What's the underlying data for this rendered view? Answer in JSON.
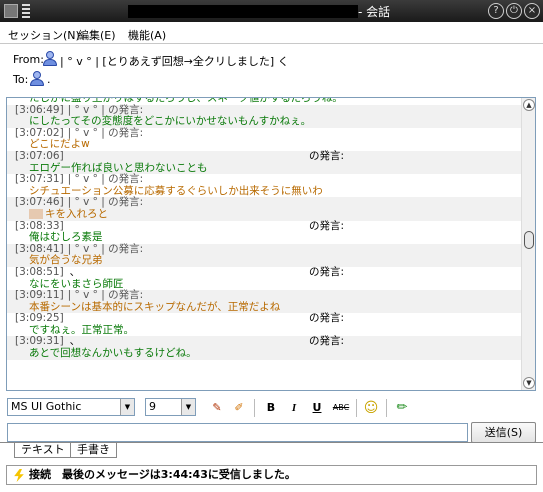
{
  "window": {
    "title": "- 会話",
    "controls": [
      "help-icon",
      "minimize-icon",
      "close-icon"
    ]
  },
  "menu": {
    "items": [
      {
        "label": "セッション(N)"
      },
      {
        "label": "編集(E)"
      },
      {
        "label": "機能(A)"
      }
    ]
  },
  "header": {
    "from_label": "From:",
    "from_value": "| ° v ° | [とりあえず回想→全クリしました] く",
    "to_label": "To:",
    "to_value": "."
  },
  "chat": {
    "said_label": "の発言:",
    "lines": [
      {
        "kind": "msg",
        "color": "green",
        "text": "たしかに盛り上がりはするだろうし、スネーク値がするだろうね。"
      },
      {
        "kind": "hdr",
        "ts": "[3:06:49]",
        "nick": "| ° v ° | の発言:",
        "alt": true
      },
      {
        "kind": "msg",
        "color": "green",
        "text": "にしたってその変態度をどこかにいかせないもんすかねぇ。",
        "alt": true
      },
      {
        "kind": "hdr",
        "ts": "[3:07:02]",
        "nick": "| ° v ° | の発言:"
      },
      {
        "kind": "msg",
        "color": "orange",
        "text": "どこにだよw"
      },
      {
        "kind": "hdr",
        "ts": "[3:07:06]",
        "nick": "",
        "alt": true
      },
      {
        "kind": "msg",
        "color": "green",
        "text": "エロゲー作れば良いと思わないことも",
        "alt": true
      },
      {
        "kind": "hdr",
        "ts": "[3:07:31]",
        "nick": "| ° v ° | の発言:"
      },
      {
        "kind": "msg",
        "color": "orange",
        "text": "シチュエーション公募に応募するぐらいしか出来そうに無いわ"
      },
      {
        "kind": "hdr",
        "ts": "[3:07:46]",
        "nick": "| ° v ° | の発言:",
        "alt": true
      },
      {
        "kind": "msg",
        "color": "orange",
        "text": "キを入れろと",
        "alt": true,
        "redact_prefix": true
      },
      {
        "kind": "hdr",
        "ts": "[3:08:33]",
        "nick": ""
      },
      {
        "kind": "msg",
        "color": "green",
        "text": "俺はむしろ素是"
      },
      {
        "kind": "hdr",
        "ts": "[3:08:41]",
        "nick": "| ° v ° | の発言:",
        "alt": true
      },
      {
        "kind": "msg",
        "color": "orange",
        "text": "気が合うな兄弟",
        "alt": true
      },
      {
        "kind": "hdr",
        "ts": "[3:08:51]",
        "nick": "、"
      },
      {
        "kind": "msg",
        "color": "green",
        "text": "なにをいまさら師匠"
      },
      {
        "kind": "hdr",
        "ts": "[3:09:11]",
        "nick": "| ° v ° | の発言:",
        "alt": true
      },
      {
        "kind": "msg",
        "color": "orange",
        "text": "本番シーンは基本的にスキップなんだが、正常だよね",
        "alt": true
      },
      {
        "kind": "hdr",
        "ts": "[3:09:25]",
        "nick": ""
      },
      {
        "kind": "msg",
        "color": "green",
        "text": "ですねぇ。正常正常。"
      },
      {
        "kind": "hdr",
        "ts": "[3:09:31]",
        "nick": "、",
        "alt": true
      },
      {
        "kind": "msg",
        "color": "green",
        "text": "あとで回想なんかいもするけどね。",
        "alt": true
      }
    ]
  },
  "toolbar": {
    "font_value": "MS UI Gothic",
    "size_value": "9",
    "bold": "B",
    "italic": "I",
    "underline": "U",
    "strike": "ABC"
  },
  "compose": {
    "send_label": "送信(S)"
  },
  "tabs": [
    {
      "label": "テキスト"
    },
    {
      "label": "手書き"
    }
  ],
  "status": {
    "text": "接続　最後のメッセージは3:44:43に受信しました。"
  },
  "colors": {
    "green_msg": "#0a7a0a",
    "orange_msg": "#b86a00"
  }
}
